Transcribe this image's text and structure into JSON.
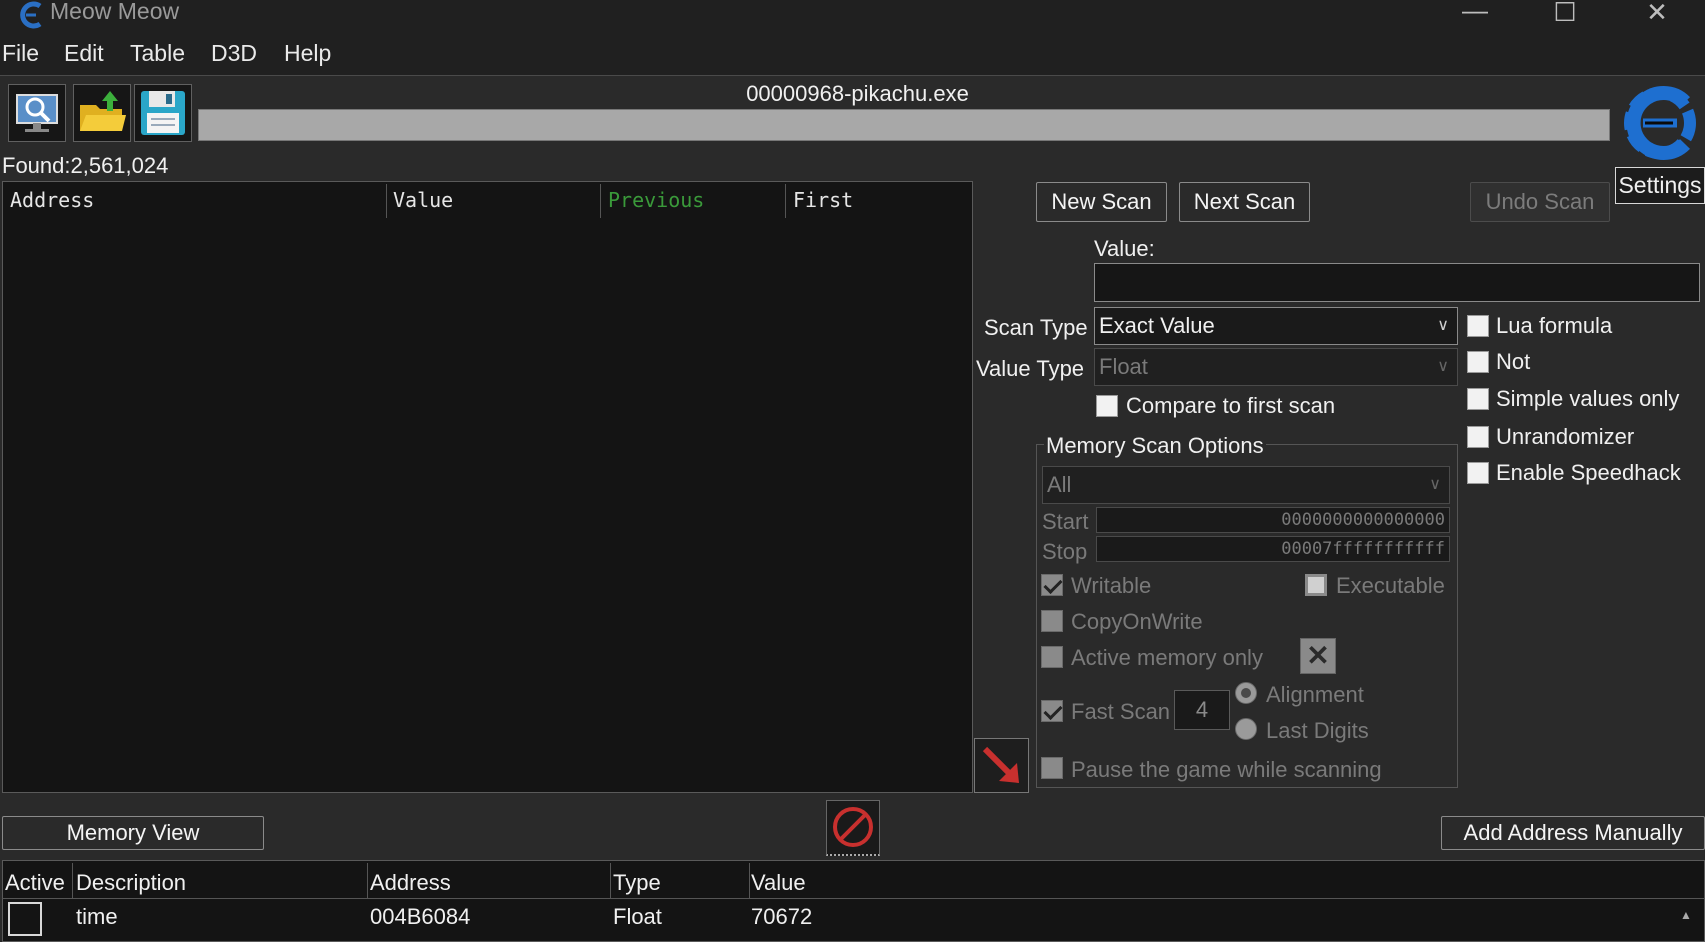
{
  "window": {
    "title": "Meow Meow",
    "minimize": "—",
    "maximize": "☐",
    "close": "✕"
  },
  "menu": [
    "File",
    "Edit",
    "Table",
    "D3D",
    "Help"
  ],
  "process": "00000968-pikachu.exe",
  "found": "Found:2,561,024",
  "settings_label": "Settings",
  "results_columns": [
    "Address",
    "Value",
    "Previous",
    "First"
  ],
  "scan": {
    "new_scan": "New Scan",
    "next_scan": "Next Scan",
    "undo_scan": "Undo Scan",
    "value_label": "Value:",
    "value_input": "",
    "scan_type_label": "Scan Type",
    "scan_type_value": "Exact Value",
    "value_type_label": "Value Type",
    "value_type_value": "Float",
    "compare_first": "Compare to first scan"
  },
  "right_options": [
    "Lua formula",
    "Not",
    "Simple values only",
    "Unrandomizer",
    "Enable Speedhack"
  ],
  "memory": {
    "title": "Memory Scan Options",
    "region": "All",
    "start_label": "Start",
    "start_value": "0000000000000000",
    "stop_label": "Stop",
    "stop_value": "00007fffffffffff",
    "writable": "Writable",
    "executable": "Executable",
    "copy_on_write": "CopyOnWrite",
    "active_only": "Active memory only",
    "fast_scan": "Fast Scan",
    "fast_scan_value": "4",
    "alignment": "Alignment",
    "last_digits": "Last Digits",
    "pause": "Pause the game while scanning"
  },
  "memory_view_label": "Memory View",
  "add_address_label": "Add Address Manually",
  "table_columns": [
    "Active",
    "Description",
    "Address",
    "Type",
    "Value"
  ],
  "table_rows": [
    {
      "description": "time",
      "address": "004B6084",
      "type": "Float",
      "value": "70672"
    }
  ],
  "colors": {
    "previous_header": "#3a9a3a",
    "accent": "#1e6fd0",
    "arrow": "#c8302e"
  }
}
